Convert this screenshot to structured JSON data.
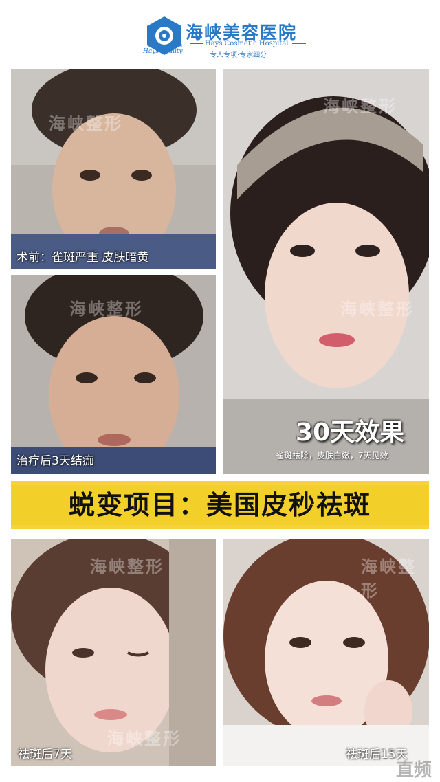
{
  "header": {
    "brand_cn": "海峡美容医院",
    "brand_en": "Hays Cosmetic Hospital",
    "brand_tagline": "专人专项·专家细分",
    "brand_script": "Hays Beauty",
    "registered": "®",
    "logo_icon": "hays-logo-icon"
  },
  "watermark": "海峡整形",
  "panels": {
    "before": {
      "caption": "术前：雀斑严重  皮肤暗黄"
    },
    "day3": {
      "caption": "治疗后3天结痂"
    },
    "day30": {
      "title": "30天效果",
      "subtitle": "雀斑祛除，皮肤白嫩，7天见效"
    },
    "day7": {
      "caption": "祛斑后7天"
    },
    "day15": {
      "caption": "祛斑后15天"
    }
  },
  "banner": {
    "text": "蜕变项目：美国皮秒祛斑"
  },
  "corner_watermark": "直频",
  "colors": {
    "brand_blue": "#2a79c6",
    "banner_yellow": "#f3cf2a"
  }
}
